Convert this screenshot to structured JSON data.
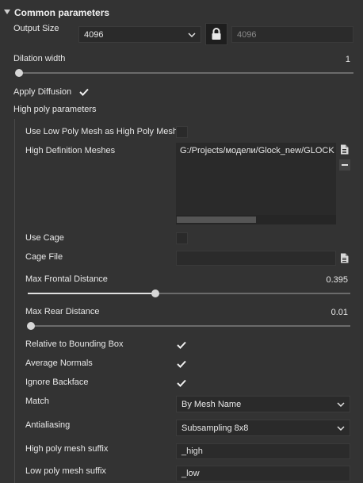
{
  "section": {
    "title": "Common parameters"
  },
  "output_size": {
    "label": "Output Size",
    "width_value": "4096",
    "height_value": "4096",
    "locked": true
  },
  "dilation": {
    "label": "Dilation width",
    "value": "1",
    "fraction": 0.0
  },
  "apply_diffusion": {
    "label": "Apply Diffusion",
    "checked": true
  },
  "high_poly": {
    "title": "High poly parameters",
    "use_low_as_high": {
      "label": "Use Low Poly Mesh as High Poly Mesh",
      "checked": false
    },
    "hd_meshes": {
      "label": "High Definition Meshes",
      "item": "G:/Projects/модели/Glock_new/GLOCK"
    },
    "use_cage": {
      "label": "Use Cage",
      "checked": false
    },
    "cage_file": {
      "label": "Cage File",
      "value": ""
    },
    "max_frontal": {
      "label": "Max Frontal Distance",
      "value": "0.395",
      "fraction": 0.395
    },
    "max_rear": {
      "label": "Max Rear Distance",
      "value": "0.01",
      "fraction": 0.01
    },
    "relative_bbox": {
      "label": "Relative to Bounding Box",
      "checked": true
    },
    "average_normals": {
      "label": "Average Normals",
      "checked": true
    },
    "ignore_backface": {
      "label": "Ignore Backface",
      "checked": true
    },
    "match": {
      "label": "Match",
      "value": "By Mesh Name"
    },
    "antialiasing": {
      "label": "Antialiasing",
      "value": "Subsampling 8x8"
    },
    "high_suffix": {
      "label": "High poly mesh suffix",
      "value": "_high"
    },
    "low_suffix": {
      "label": "Low poly mesh suffix",
      "value": "_low"
    }
  },
  "colors": {
    "background": "#333333",
    "field": "#2a2a2a",
    "text": "#e8e8e8",
    "knob": "#d7d7d7"
  },
  "icons": [
    "collapse-triangle-icon",
    "chevron-down-icon",
    "lock-icon",
    "file-icon",
    "minus-icon",
    "checkmark-icon"
  ]
}
